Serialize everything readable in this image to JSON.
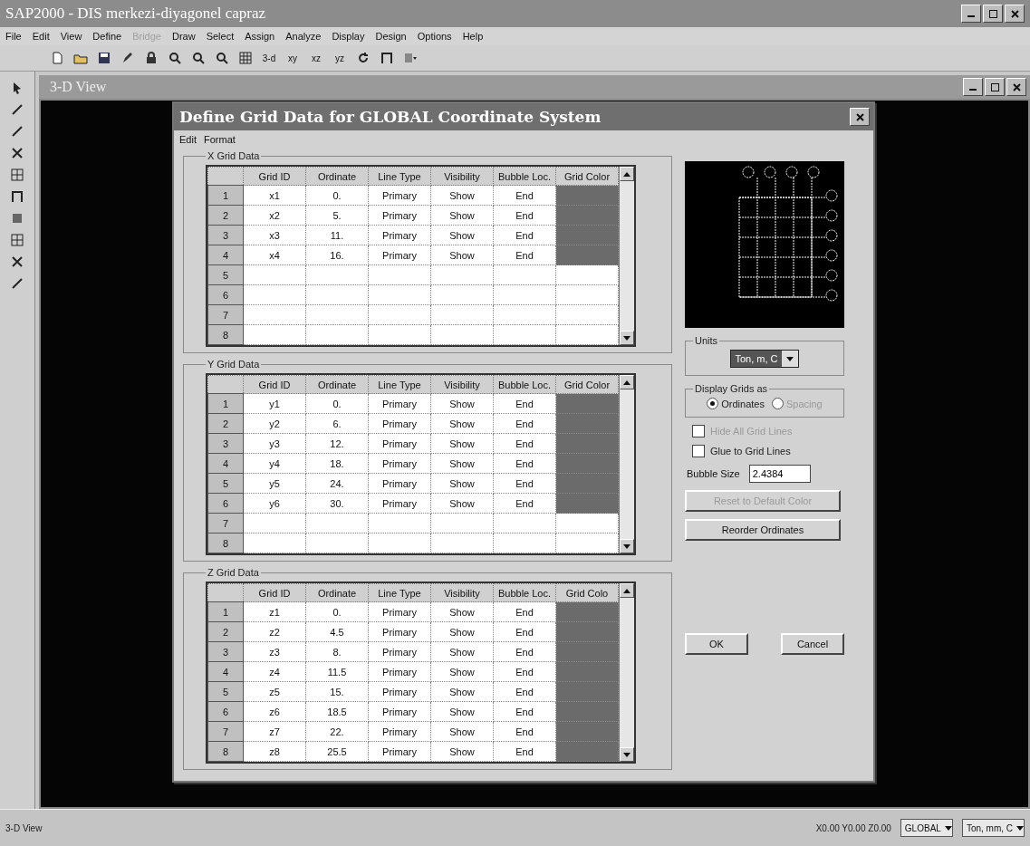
{
  "app": {
    "title": "SAP2000 - DIS merkezi-diyagonel capraz"
  },
  "menu": [
    {
      "label": "File",
      "disabled": false
    },
    {
      "label": "Edit",
      "disabled": false
    },
    {
      "label": "View",
      "disabled": false
    },
    {
      "label": "Define",
      "disabled": false
    },
    {
      "label": "Bridge",
      "disabled": true
    },
    {
      "label": "Draw",
      "disabled": false
    },
    {
      "label": "Select",
      "disabled": false
    },
    {
      "label": "Assign",
      "disabled": false
    },
    {
      "label": "Analyze",
      "disabled": false
    },
    {
      "label": "Display",
      "disabled": false
    },
    {
      "label": "Design",
      "disabled": false
    },
    {
      "label": "Options",
      "disabled": false
    },
    {
      "label": "Help",
      "disabled": false
    }
  ],
  "toolbar": {
    "view_buttons": [
      "3-d",
      "xy",
      "xz",
      "yz"
    ]
  },
  "child_window": {
    "title": "3-D View"
  },
  "dialog": {
    "title": "Define Grid Data for GLOBAL Coordinate System",
    "menu": [
      "Edit",
      "Format"
    ],
    "grids": [
      {
        "title": "X Grid Data",
        "columns": [
          "Grid ID",
          "Ordinate",
          "Line Type",
          "Visibility",
          "Bubble Loc.",
          "Grid Color"
        ],
        "rows": [
          {
            "number": "1",
            "cells": [
              "x1",
              "0.",
              "Primary",
              "Show",
              "End"
            ],
            "color": "#6b6b6b"
          },
          {
            "number": "2",
            "cells": [
              "x2",
              "5.",
              "Primary",
              "Show",
              "End"
            ],
            "color": "#6b6b6b"
          },
          {
            "number": "3",
            "cells": [
              "x3",
              "11.",
              "Primary",
              "Show",
              "End"
            ],
            "color": "#6b6b6b"
          },
          {
            "number": "4",
            "cells": [
              "x4",
              "16.",
              "Primary",
              "Show",
              "End"
            ],
            "color": "#6b6b6b"
          },
          {
            "number": "5"
          },
          {
            "number": "6"
          },
          {
            "number": "7"
          },
          {
            "number": "8"
          }
        ]
      },
      {
        "title": "Y Grid Data",
        "columns": [
          "Grid ID",
          "Ordinate",
          "Line Type",
          "Visibility",
          "Bubble Loc.",
          "Grid Color"
        ],
        "rows": [
          {
            "number": "1",
            "cells": [
              "y1",
              "0.",
              "Primary",
              "Show",
              "End"
            ],
            "color": "#6b6b6b"
          },
          {
            "number": "2",
            "cells": [
              "y2",
              "6.",
              "Primary",
              "Show",
              "End"
            ],
            "color": "#6b6b6b"
          },
          {
            "number": "3",
            "cells": [
              "y3",
              "12.",
              "Primary",
              "Show",
              "End"
            ],
            "color": "#6b6b6b"
          },
          {
            "number": "4",
            "cells": [
              "y4",
              "18.",
              "Primary",
              "Show",
              "End"
            ],
            "color": "#6b6b6b"
          },
          {
            "number": "5",
            "cells": [
              "y5",
              "24.",
              "Primary",
              "Show",
              "End"
            ],
            "color": "#6b6b6b"
          },
          {
            "number": "6",
            "cells": [
              "y6",
              "30.",
              "Primary",
              "Show",
              "End"
            ],
            "color": "#6b6b6b"
          },
          {
            "number": "7"
          },
          {
            "number": "8"
          }
        ]
      },
      {
        "title": "Z Grid Data",
        "columns": [
          "Grid ID",
          "Ordinate",
          "Line Type",
          "Visibility",
          "Bubble Loc.",
          "Grid Colo"
        ],
        "rows": [
          {
            "number": "1",
            "cells": [
              "z1",
              "0.",
              "Primary",
              "Show",
              "End"
            ],
            "color": "#6b6b6b"
          },
          {
            "number": "2",
            "cells": [
              "z2",
              "4.5",
              "Primary",
              "Show",
              "End"
            ],
            "color": "#6b6b6b"
          },
          {
            "number": "3",
            "cells": [
              "z3",
              "8.",
              "Primary",
              "Show",
              "End"
            ],
            "color": "#6b6b6b"
          },
          {
            "number": "4",
            "cells": [
              "z4",
              "11.5",
              "Primary",
              "Show",
              "End"
            ],
            "color": "#6b6b6b"
          },
          {
            "number": "5",
            "cells": [
              "z5",
              "15.",
              "Primary",
              "Show",
              "End"
            ],
            "color": "#6b6b6b"
          },
          {
            "number": "6",
            "cells": [
              "z6",
              "18.5",
              "Primary",
              "Show",
              "End"
            ],
            "color": "#6b6b6b"
          },
          {
            "number": "7",
            "cells": [
              "z7",
              "22.",
              "Primary",
              "Show",
              "End"
            ],
            "color": "#6b6b6b"
          },
          {
            "number": "8",
            "cells": [
              "z8",
              "25.5",
              "Primary",
              "Show",
              "End"
            ],
            "color": "#6b6b6b"
          }
        ]
      }
    ],
    "units": {
      "label": "Units",
      "value": "Ton, m, C"
    },
    "display_grids": {
      "label": "Display Grids as",
      "options": [
        {
          "label": "Ordinates",
          "selected": true,
          "disabled": false
        },
        {
          "label": "Spacing",
          "selected": false,
          "disabled": true
        }
      ]
    },
    "checkboxes": [
      {
        "label": "Hide All Grid Lines",
        "checked": false,
        "disabled": true
      },
      {
        "label": "Glue to Grid Lines",
        "checked": false,
        "disabled": false
      }
    ],
    "bubble_size": {
      "label": "Bubble Size",
      "value": "2.4384"
    },
    "buttons": [
      {
        "label": "Reset to Default Color",
        "disabled": true
      },
      {
        "label": "Reorder Ordinates",
        "disabled": false
      }
    ],
    "footer_buttons": [
      {
        "label": "OK",
        "disabled": false
      },
      {
        "label": "Cancel",
        "disabled": false
      }
    ]
  },
  "status_bar": {
    "view": "3-D View",
    "coordinates": "X0.00 Y0.00 Z0.00",
    "system": "GLOBAL",
    "units": "Ton, mm, C"
  }
}
